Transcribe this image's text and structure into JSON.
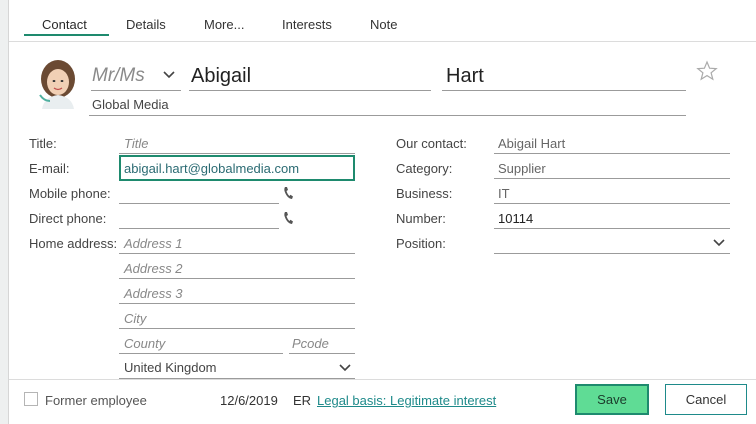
{
  "tabs": [
    {
      "label": "Contact"
    },
    {
      "label": "Details"
    },
    {
      "label": "More..."
    },
    {
      "label": "Interests"
    },
    {
      "label": "Note"
    }
  ],
  "header": {
    "salutation_placeholder": "Mr/Ms",
    "first_name": "Abigail",
    "last_name": "Hart",
    "company": "Global Media"
  },
  "left": {
    "title_label": "Title:",
    "title_placeholder": "Title",
    "email_label": "E-mail:",
    "email_value": "abigail.hart@globalmedia.com",
    "mobile_label": "Mobile phone:",
    "direct_label": "Direct phone:",
    "home_label": "Home address:",
    "address1_placeholder": "Address 1",
    "address2_placeholder": "Address 2",
    "address3_placeholder": "Address 3",
    "city_placeholder": "City",
    "county_placeholder": "County",
    "pcode_placeholder": "Pcode",
    "country_value": "United Kingdom"
  },
  "right": {
    "our_contact_label": "Our contact:",
    "our_contact_value": "Abigail Hart",
    "category_label": "Category:",
    "category_value": "Supplier",
    "business_label": "Business:",
    "business_value": "IT",
    "number_label": "Number:",
    "number_value": "10114",
    "position_label": "Position:"
  },
  "footer": {
    "former_employee_label": "Former employee",
    "date": "12/6/2019",
    "initials": "ER",
    "legal_basis_link": "Legal basis: Legitimate interest",
    "save_label": "Save",
    "cancel_label": "Cancel"
  },
  "colors": {
    "accent": "#1e8a6e",
    "save_button": "#5fdc95",
    "link": "#1e8a8a"
  },
  "icons": [
    "avatar",
    "chevron-down-icon",
    "star-icon",
    "phone-icon",
    "checkbox"
  ]
}
